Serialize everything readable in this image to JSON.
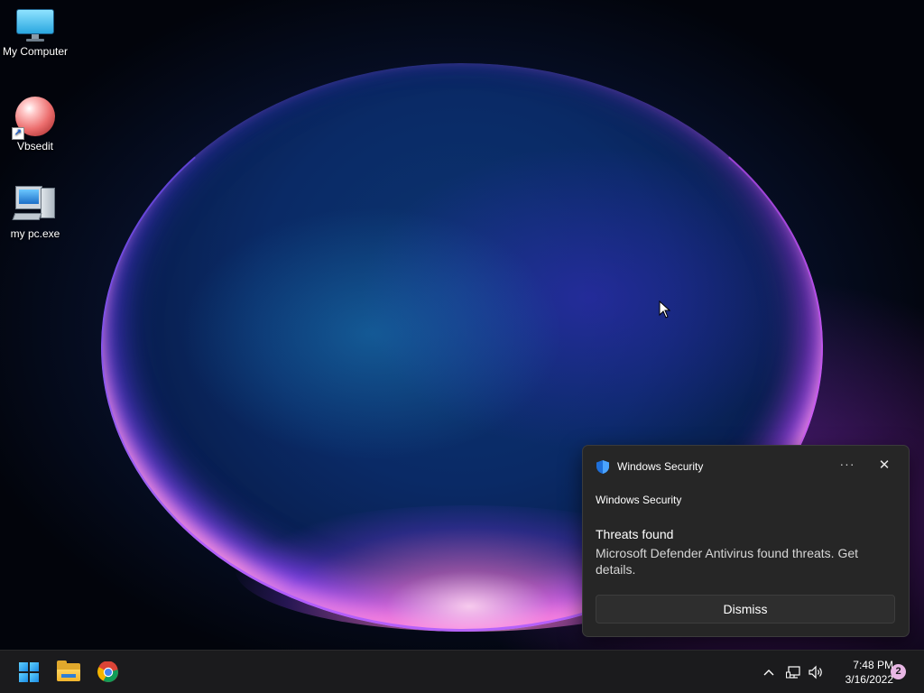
{
  "desktop": {
    "icons": [
      {
        "label": "My Computer",
        "icon": "monitor-icon"
      },
      {
        "label": "Vbsedit",
        "icon": "sphere-shortcut-icon"
      },
      {
        "label": "my pc.exe",
        "icon": "computer-exe-icon"
      }
    ]
  },
  "toast": {
    "app_name": "Windows Security",
    "more_label": "···",
    "close_label": "✕",
    "attribution": "Windows Security",
    "title": "Threats found",
    "body": "Microsoft Defender Antivirus found threats. Get details.",
    "dismiss_label": "Dismiss"
  },
  "taskbar": {
    "pinned": [
      "start-icon",
      "file-explorer-icon",
      "chrome-icon"
    ],
    "tray": {
      "chevron_label": "^",
      "time": "7:48 PM",
      "date": "3/16/2022",
      "notification_count": "2"
    }
  },
  "colors": {
    "accent": "#1c8ce3",
    "toast_bg": "#262626",
    "taskbar_bg": "#1b1b1d",
    "badge": "#e8b7e4"
  }
}
